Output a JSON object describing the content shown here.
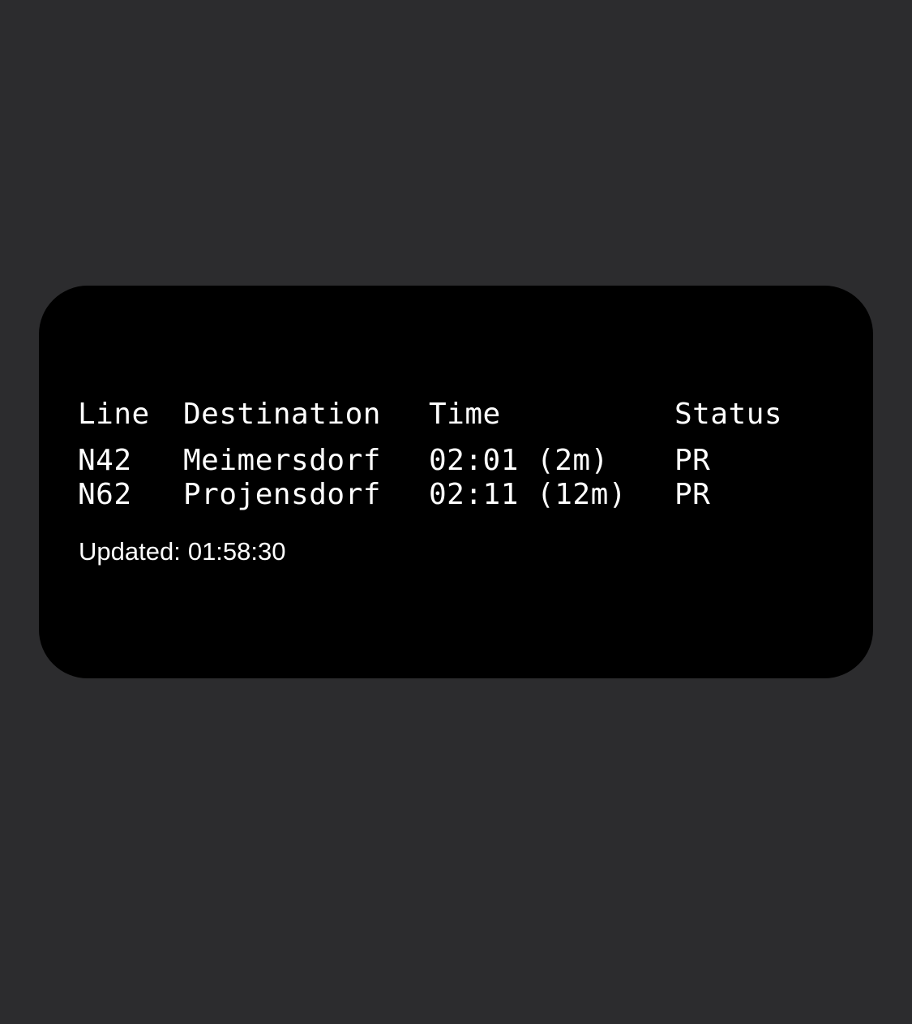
{
  "colors": {
    "background": "#2c2c2e",
    "widget": "#000000",
    "text": "#ffffff"
  },
  "table": {
    "headers": {
      "line": "Line",
      "destination": "Destination",
      "time": "Time",
      "status": "Status"
    },
    "rows": [
      {
        "line": "N42",
        "destination": "Meimersdorf",
        "time": "02:01 (2m)",
        "status": "PR"
      },
      {
        "line": "N62",
        "destination": "Projensdorf",
        "time": "02:11 (12m)",
        "status": "PR"
      }
    ]
  },
  "footer": {
    "updated_label": "Updated:",
    "updated_time": "01:58:30"
  }
}
